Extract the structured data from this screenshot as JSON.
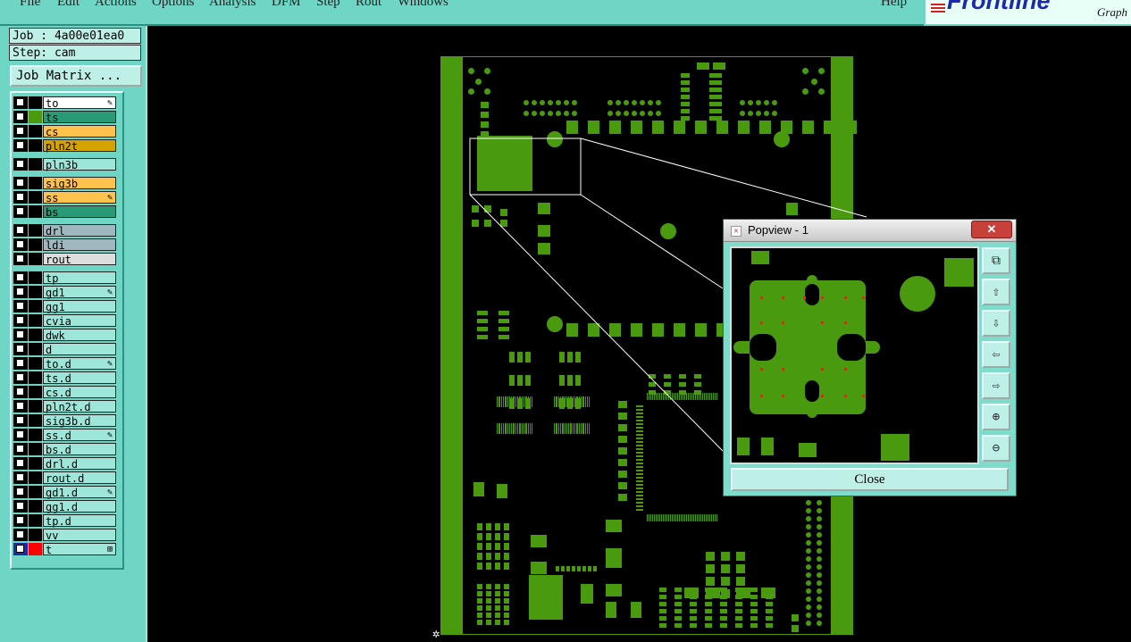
{
  "menu": {
    "file": "File",
    "edit": "Edit",
    "actions": "Actions",
    "options": "Options",
    "analysis": "Analysis",
    "dfm": "DFM",
    "step": "Step",
    "rout": "Rout",
    "windows": "Windows",
    "help": "Help"
  },
  "logo": {
    "brand": "Frontline",
    "sub": "Graph"
  },
  "job": {
    "label": "Job : 4a00e01ea0"
  },
  "step": {
    "label": "Step: cam"
  },
  "job_matrix_button": "Job Matrix ...",
  "layers": [
    {
      "name": "to",
      "color": "#ffffff",
      "mark": "✎"
    },
    {
      "name": "ts",
      "color": "#2a9a76",
      "mark": ""
    },
    {
      "name": "cs",
      "color": "#ffc24d",
      "mark": ""
    },
    {
      "name": "pln2t",
      "color": "#d5a300",
      "mark": ""
    },
    {
      "name": "pln3b",
      "color": "#9ee6da",
      "mark": ""
    },
    {
      "name": "sig3b",
      "color": "#ffc24d",
      "mark": ""
    },
    {
      "name": "ss",
      "color": "#ffc24d",
      "mark": "✎"
    },
    {
      "name": "bs",
      "color": "#2a9a76",
      "mark": ""
    },
    {
      "name": "drl",
      "color": "#9fb8c0",
      "mark": ""
    },
    {
      "name": "ldi",
      "color": "#9fb8c0",
      "mark": ""
    },
    {
      "name": "rout",
      "color": "#dddddd",
      "mark": ""
    },
    {
      "name": "tp",
      "color": "#9ee6da",
      "mark": ""
    },
    {
      "name": "gd1",
      "color": "#9ee6da",
      "mark": "✎"
    },
    {
      "name": "gg1",
      "color": "#9ee6da",
      "mark": ""
    },
    {
      "name": "cvia",
      "color": "#9ee6da",
      "mark": ""
    },
    {
      "name": "dwk",
      "color": "#9ee6da",
      "mark": ""
    },
    {
      "name": "d",
      "color": "#9ee6da",
      "mark": ""
    },
    {
      "name": "to.d",
      "color": "#9ee6da",
      "mark": "✎"
    },
    {
      "name": "ts.d",
      "color": "#9ee6da",
      "mark": ""
    },
    {
      "name": "cs.d",
      "color": "#9ee6da",
      "mark": ""
    },
    {
      "name": "pln2t.d",
      "color": "#9ee6da",
      "mark": ""
    },
    {
      "name": "sig3b.d",
      "color": "#9ee6da",
      "mark": ""
    },
    {
      "name": "ss.d",
      "color": "#9ee6da",
      "mark": "✎"
    },
    {
      "name": "bs.d",
      "color": "#9ee6da",
      "mark": ""
    },
    {
      "name": "drl.d",
      "color": "#9ee6da",
      "mark": ""
    },
    {
      "name": "rout.d",
      "color": "#9ee6da",
      "mark": ""
    },
    {
      "name": "gd1.d",
      "color": "#9ee6da",
      "mark": "✎"
    },
    {
      "name": "gg1.d",
      "color": "#9ee6da",
      "mark": ""
    },
    {
      "name": "tp.d",
      "color": "#9ee6da",
      "mark": ""
    },
    {
      "name": "vv",
      "color": "#9ee6da",
      "mark": ""
    },
    {
      "name": "t",
      "color": "#9ee6da",
      "mark": "⊞"
    }
  ],
  "popup": {
    "title": "Popview - 1",
    "close_x": "✕",
    "close_button": "Close",
    "tools": [
      "zoom-fit-icon",
      "pan-up-icon",
      "pan-down-icon",
      "pan-left-icon",
      "pan-right-icon",
      "zoom-in-icon",
      "zoom-out-icon"
    ]
  },
  "colors": {
    "panel": "#6fd6c6",
    "copper": "#4a9a10",
    "highlight_layer": "#ff0000"
  }
}
